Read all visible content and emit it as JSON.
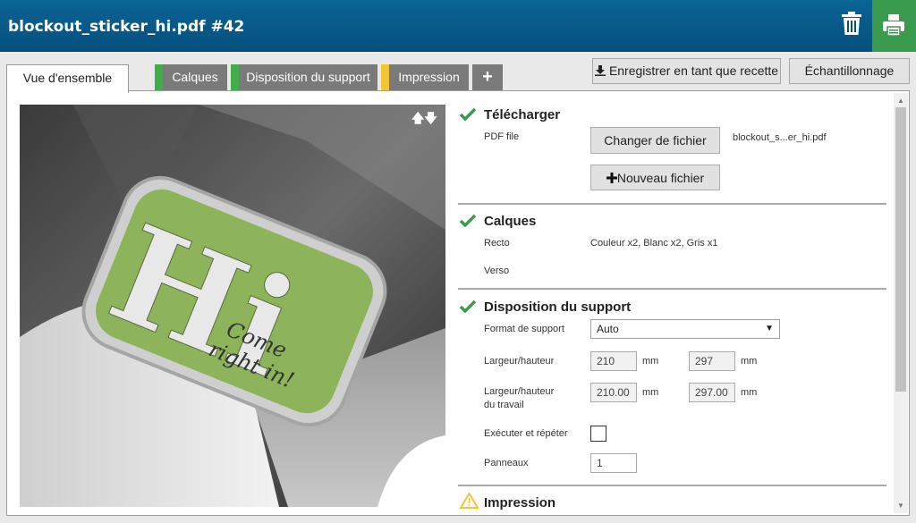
{
  "header": {
    "title": "blockout_sticker_hi.pdf #42",
    "trash_icon": "trash-icon",
    "print_icon": "printer-icon",
    "print_color": "#3a9a4e"
  },
  "tabs": [
    {
      "label": "Vue d'ensemble",
      "color": ""
    },
    {
      "label": "Calques",
      "color": "#3fae49"
    },
    {
      "label": "Disposition du support",
      "color": "#3fae49"
    },
    {
      "label": "Impression",
      "color": "#f2c538"
    }
  ],
  "add_tab_symbol": "+",
  "toolbar": {
    "save_recipe": "Enregistrer en tant que recette",
    "sampling": "Échantillonnage"
  },
  "preview": {
    "arrows_up": "🡅",
    "arrows_down": "🡇",
    "sticker_big": "Hi",
    "sticker_line1": "Come",
    "sticker_line2": "right in!"
  },
  "upload": {
    "title": "Télécharger",
    "pdf_label": "PDF file",
    "change_file": "Changer de fichier",
    "file_name": "blockout_s...er_hi.pdf",
    "new_file": "Nouveau fichier",
    "new_file_icon": "plus-icon"
  },
  "layers": {
    "title": "Calques",
    "front_label": "Recto",
    "front_value": "Couleur x2, Blanc x2, Gris x1",
    "back_label": "Verso"
  },
  "media": {
    "title": "Disposition du support",
    "format_label": "Format de support",
    "format_value": "Auto",
    "size_label": "Largeur/hauteur",
    "width": "210",
    "height": "297",
    "unit": "mm",
    "work_label_1": "Largeur/hauteur",
    "work_label_2": "du travail",
    "work_width": "210.00",
    "work_height": "297.00",
    "step_label": "Exécuter et répéter",
    "panels_label": "Panneaux",
    "panels_value": "1"
  },
  "print": {
    "title": "Impression",
    "status_icon": "warning-icon"
  },
  "colors": {
    "header": "#064f7c",
    "check": "#3a9a4e",
    "warning": "#f2c538"
  }
}
